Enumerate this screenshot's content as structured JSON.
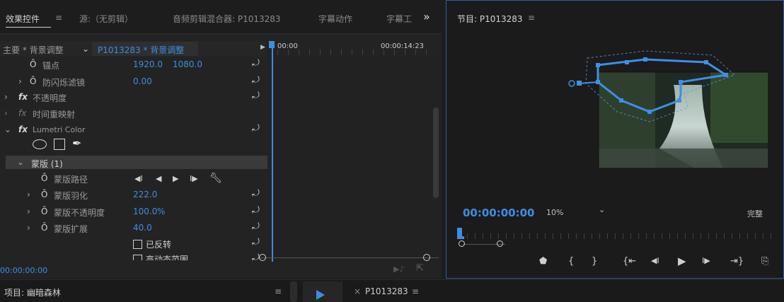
{
  "tabs": {
    "effects": "效果控件",
    "menu_glyph": "≡",
    "source": "源:（无剪辑）",
    "audio_mixer": "音频剪辑混合器: P1013283",
    "caption_motion": "字幕动作",
    "caption": "字幕工",
    "overflow": "»",
    "program": "节目: P1013283"
  },
  "ec_header": {
    "master": "主要 * 背景调整",
    "clip": "P1013283 * 背景调整",
    "time_start": "00:00",
    "time_end": "00:00:14:23"
  },
  "rows": {
    "anchor_label": "锚点",
    "anchor_x": "1920.0",
    "anchor_y": "1080.0",
    "antiflicker_label": "防闪烁滤镜",
    "antiflicker_value": "0.00",
    "opacity_label": "不透明度",
    "timeremap_label": "时间重映射",
    "lumetri_label": "Lumetri Color",
    "mask_label": "蒙版 (1)",
    "mask_path_label": "蒙版路径",
    "mask_feather_label": "蒙版羽化",
    "mask_feather_value": "222.0",
    "mask_opacity_label": "蒙版不透明度",
    "mask_opacity_value": "100.0",
    "mask_opacity_unit": "%",
    "mask_expand_label": "蒙版扩展",
    "mask_expand_value": "40.0",
    "inverted_label": "已反转",
    "hq_label": "高动态范围"
  },
  "ec_footer": {
    "timecode": "00:00:00:00"
  },
  "program": {
    "timecode": "00:00:00:00",
    "zoom": "10%",
    "quality": "完整"
  },
  "bottom": {
    "project": "项目: 幽暗森林",
    "sequence_tab": "P1013283"
  },
  "colors": {
    "accent": "#3b8ee6",
    "mask_path": "#3d8fe8"
  }
}
